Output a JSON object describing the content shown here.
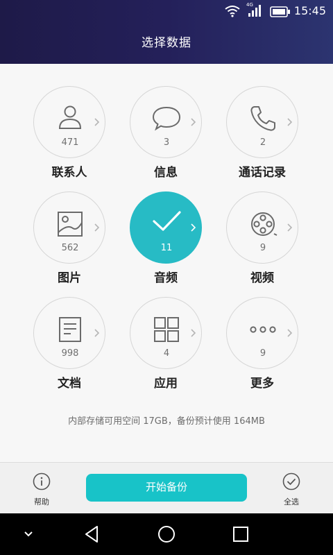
{
  "status_bar": {
    "time": "15:45",
    "network": "4G",
    "icons": [
      "wifi-icon",
      "signal-icon",
      "battery-icon"
    ]
  },
  "header": {
    "title": "选择数据"
  },
  "categories": [
    {
      "label": "联系人",
      "count": "471",
      "icon": "contact-icon",
      "selected": false
    },
    {
      "label": "信息",
      "count": "3",
      "icon": "message-icon",
      "selected": false
    },
    {
      "label": "通话记录",
      "count": "2",
      "icon": "phone-icon",
      "selected": false
    },
    {
      "label": "图片",
      "count": "562",
      "icon": "image-icon",
      "selected": false
    },
    {
      "label": "音频",
      "count": "11",
      "icon": "check-icon",
      "selected": true
    },
    {
      "label": "视频",
      "count": "9",
      "icon": "video-reel-icon",
      "selected": false
    },
    {
      "label": "文档",
      "count": "998",
      "icon": "document-icon",
      "selected": false
    },
    {
      "label": "应用",
      "count": "4",
      "icon": "apps-grid-icon",
      "selected": false
    },
    {
      "label": "更多",
      "count": "9",
      "icon": "more-dots-icon",
      "selected": false
    }
  ],
  "storage_info": "内部存储可用空间 17GB，备份预计使用 164MB",
  "bottom_bar": {
    "help_label": "帮助",
    "start_label": "开始备份",
    "select_all_label": "全选"
  },
  "colors": {
    "accent": "#18c3c8",
    "selected_circle": "#27bbc5",
    "header_bg": "#24205a"
  }
}
